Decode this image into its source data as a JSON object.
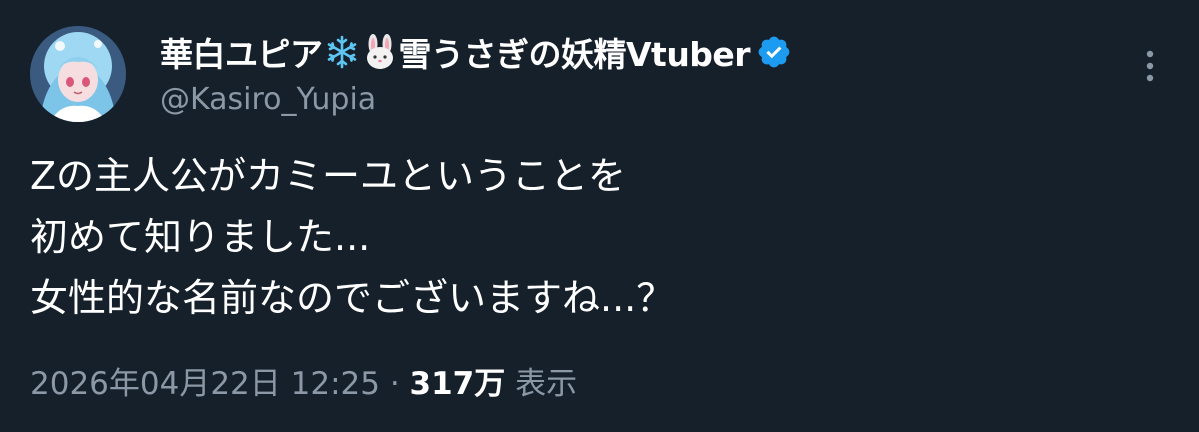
{
  "tweet": {
    "author": {
      "display_name_part1": "華白ユピア",
      "display_name_part2": "雪うさぎの妖精Vtuber",
      "handle": "@Kasiro_Yupia",
      "emoji_1": "snowflake-icon",
      "emoji_2": "rabbit-face-icon",
      "verified": true,
      "verified_color": "#1d9bf0"
    },
    "text_lines": [
      "Zの主人公がカミーユということを",
      "初めて知りました...",
      "女性的な名前なのでございますね...？"
    ],
    "meta": {
      "timestamp": "2026年04月22日 12:25",
      "separator": " · ",
      "views_count": "317万",
      "views_label": "表示"
    }
  },
  "colors": {
    "background": "#15202b",
    "primary_text": "#ffffff",
    "secondary_text": "#8b98a5"
  }
}
